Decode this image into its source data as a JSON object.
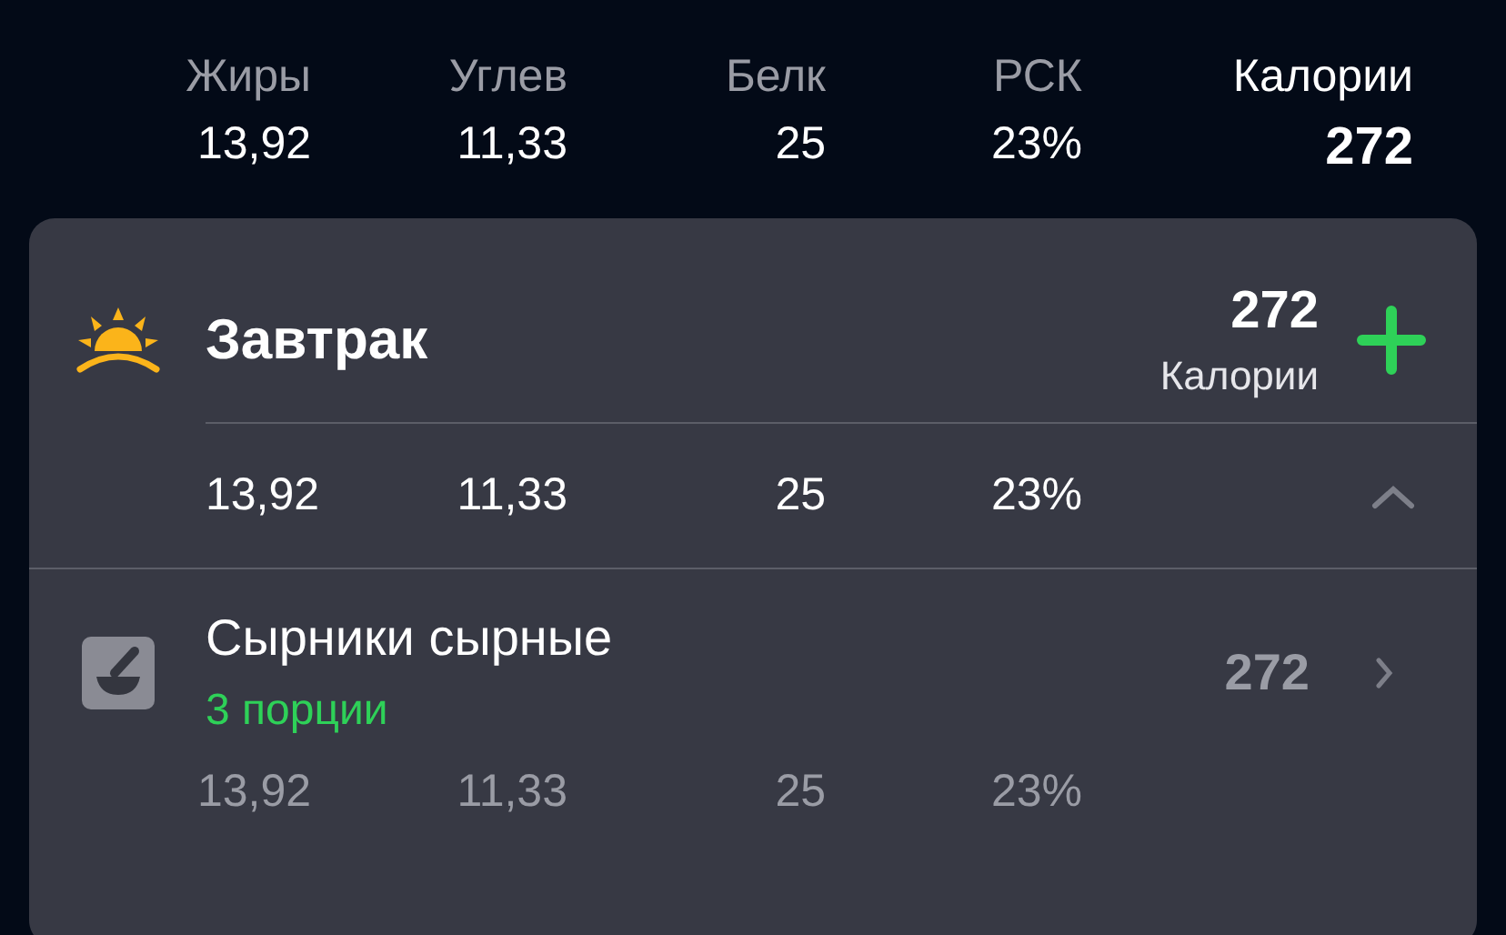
{
  "summary": [
    {
      "label": "Жиры",
      "value": "13,92"
    },
    {
      "label": "Углев",
      "value": "11,33"
    },
    {
      "label": "Белк",
      "value": "25"
    },
    {
      "label": "РСК",
      "value": "23%"
    },
    {
      "label": "Калории",
      "value": "272",
      "kind": "total"
    }
  ],
  "meal": {
    "title": "Завтрак",
    "calories": "272",
    "calories_label": "Калории",
    "expanded": true,
    "macros": [
      "13,92",
      "11,33",
      "25",
      "23%"
    ],
    "items": [
      {
        "name": "Сырники сырные",
        "portion": "3 порции",
        "calories": "272",
        "macros": [
          "13,92",
          "11,33",
          "25",
          "23%"
        ]
      }
    ]
  }
}
